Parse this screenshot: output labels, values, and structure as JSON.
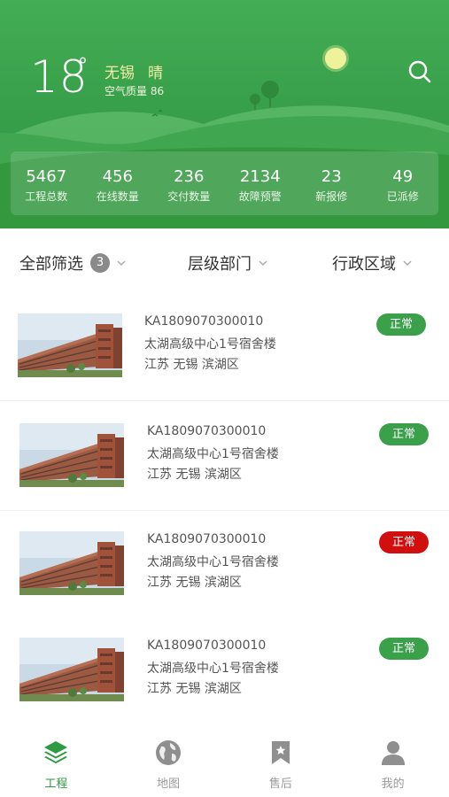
{
  "weather": {
    "temperature": "18",
    "degree_symbol": "°",
    "city": "无锡",
    "condition": "晴",
    "air_quality": "空气质量 86"
  },
  "stats": [
    {
      "value": "5467",
      "label": "工程总数"
    },
    {
      "value": "456",
      "label": "在线数量"
    },
    {
      "value": "236",
      "label": "交付数量"
    },
    {
      "value": "2134",
      "label": "故障预警"
    },
    {
      "value": "23",
      "label": "新报修"
    },
    {
      "value": "49",
      "label": "已派修"
    }
  ],
  "filters": {
    "all": {
      "label": "全部筛选",
      "count": "3"
    },
    "department": {
      "label": "层级部门"
    },
    "region": {
      "label": "行政区域"
    }
  },
  "projects": [
    {
      "code": "KA1809070300010",
      "name": "太湖高级中心1号宿舍楼",
      "address": "江苏 无锡 滨湖区",
      "status": "正常",
      "status_color": "#3aa14a"
    },
    {
      "code": "KA1809070300010",
      "name": "太湖高级中心1号宿舍楼",
      "address": "江苏 无锡 滨湖区",
      "status": "正常",
      "status_color": "#3aa14a"
    },
    {
      "code": "KA1809070300010",
      "name": "太湖高级中心1号宿舍楼",
      "address": "江苏 无锡 滨湖区",
      "status": "正常",
      "status_color": "#d10f0f"
    },
    {
      "code": "KA1809070300010",
      "name": "太湖高级中心1号宿舍楼",
      "address": "江苏 无锡 滨湖区",
      "status": "正常",
      "status_color": "#3aa14a"
    }
  ],
  "nav": [
    {
      "label": "工程",
      "icon": "layers-icon",
      "active": true
    },
    {
      "label": "地图",
      "icon": "globe-icon",
      "active": false
    },
    {
      "label": "售后",
      "icon": "bookmark-star-icon",
      "active": false
    },
    {
      "label": "我的",
      "icon": "user-icon",
      "active": false
    }
  ],
  "colors": {
    "brand_green": "#3aa14a",
    "alert_red": "#d10f0f",
    "active_nav": "#2e9b40"
  }
}
